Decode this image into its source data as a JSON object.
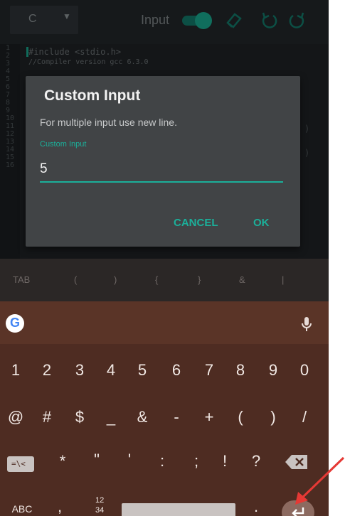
{
  "toolbar": {
    "language": "C",
    "input_label": "Input",
    "icons": [
      "eraser-icon",
      "undo-icon",
      "redo-icon"
    ]
  },
  "editor": {
    "line_numbers": [
      "1",
      "2",
      "3",
      "4",
      "5",
      "6",
      "7",
      "8",
      "9",
      "10",
      "11",
      "12",
      "13",
      "14",
      "15",
      "16"
    ],
    "code_lines": [
      "#include <stdio.h>",
      "//Compiler version gcc 6.3.0"
    ]
  },
  "dialog": {
    "title": "Custom Input",
    "message": "For multiple input use new line.",
    "field_label": "Custom Input",
    "field_value": "5",
    "cancel": "CANCEL",
    "ok": "OK"
  },
  "symbol_row": [
    "TAB",
    "(",
    ")",
    "{",
    "}",
    "&",
    "|"
  ],
  "keyboard": {
    "numbers": [
      "1",
      "2",
      "3",
      "4",
      "5",
      "6",
      "7",
      "8",
      "9",
      "0"
    ],
    "symbols1": [
      "@",
      "#",
      "$",
      "_",
      "&",
      "-",
      "+",
      "(",
      ")",
      "/"
    ],
    "symbols2": [
      "=\\<",
      "*",
      "\"",
      "'",
      ":",
      ";",
      "!",
      "?"
    ],
    "bottom": {
      "abc": "ABC",
      "comma": ",",
      "numpad_top": "12",
      "numpad_bottom": "34",
      "period": "."
    }
  },
  "colors": {
    "accent": "#1bb09a",
    "keyboard_bg": "#4e2c22",
    "annotation_arrow": "#e53935"
  }
}
